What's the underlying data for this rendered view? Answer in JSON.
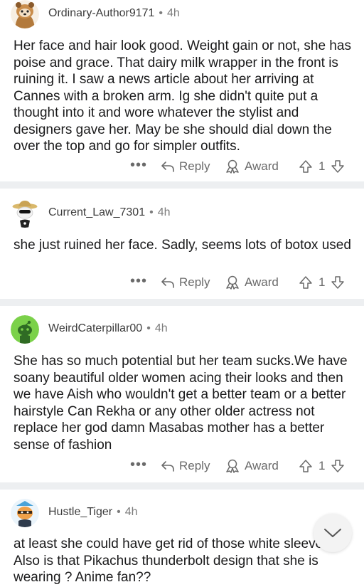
{
  "comments": [
    {
      "username": "Ordinary-Author9171",
      "dot": "•",
      "age": "4h",
      "text": "Her face and hair look good. Weight gain or not, she has poise and grace. That dairy milk wrapper in the front is ruining it. I saw a news article about her arriving at Cannes with a broken arm. Ig she didn't quite put a thought into it and wore whatever the stylist and designers gave her. May be she should dial down the over the top and go for simpler outfits.",
      "more": "•••",
      "reply": "Reply",
      "award": "Award",
      "votes": "1"
    },
    {
      "username": "Current_Law_7301",
      "dot": "•",
      "age": "4h",
      "text": "she just ruined her face. Sadly, seems lots of botox used",
      "more": "•••",
      "reply": "Reply",
      "award": "Award",
      "votes": "1"
    },
    {
      "username": "WeirdCaterpillar00",
      "dot": "•",
      "age": "4h",
      "text": "She has so much potential but her team sucks.We have soany beautiful older women acing their looks and then we have Aish who wouldn't get a better team or a better hairstyle Can Rekha or any other older actress not replace her god damn Masabas mother has a better sense of fashion",
      "more": "•••",
      "reply": "Reply",
      "award": "Award",
      "votes": "1"
    },
    {
      "username": "Hustle_Tiger",
      "dot": "•",
      "age": "4h",
      "text": "at least she could have get rid of those white sleeves . Also is that Pikachus thunderbolt design that she is wearing ? Anime fan??"
    }
  ],
  "colors": {
    "separator": "#edeff1",
    "meta": "#7c7c7c",
    "action": "#6a6a6a"
  }
}
